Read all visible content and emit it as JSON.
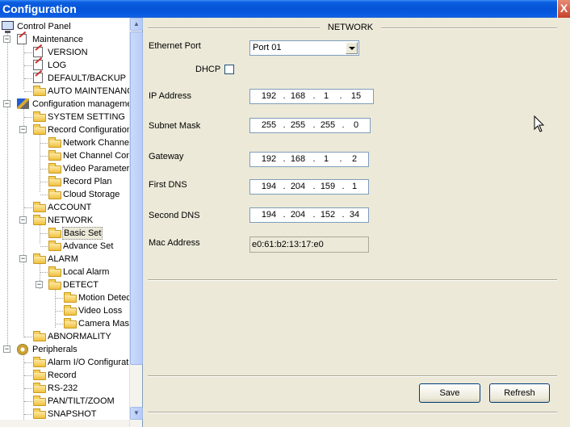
{
  "window": {
    "title": "Configuration",
    "close_label": "X"
  },
  "tree": {
    "items": [
      {
        "label": "Control Panel"
      },
      {
        "label": "Maintenance"
      },
      {
        "label": "VERSION"
      },
      {
        "label": "LOG"
      },
      {
        "label": "DEFAULT/BACKUP"
      },
      {
        "label": "AUTO MAINTENANCE"
      },
      {
        "label": "Configuration management"
      },
      {
        "label": "SYSTEM SETTING"
      },
      {
        "label": "Record Configuration"
      },
      {
        "label": "Network Channel"
      },
      {
        "label": "Net Channel Con"
      },
      {
        "label": "Video Parameter"
      },
      {
        "label": "Record Plan"
      },
      {
        "label": "Cloud Storage"
      },
      {
        "label": "ACCOUNT"
      },
      {
        "label": "NETWORK"
      },
      {
        "label": "Basic Set"
      },
      {
        "label": "Advance Set"
      },
      {
        "label": "ALARM"
      },
      {
        "label": "Local Alarm"
      },
      {
        "label": "DETECT"
      },
      {
        "label": "Motion Detect"
      },
      {
        "label": "Video Loss"
      },
      {
        "label": "Camera Mask"
      },
      {
        "label": "ABNORMALITY"
      },
      {
        "label": "Peripherals"
      },
      {
        "label": "Alarm I/O Configuration"
      },
      {
        "label": "Record"
      },
      {
        "label": "RS-232"
      },
      {
        "label": "PAN/TILT/ZOOM"
      },
      {
        "label": "SNAPSHOT"
      }
    ]
  },
  "network": {
    "section_title": "NETWORK",
    "ethernet_port_label": "Ethernet Port",
    "ethernet_port_value": "Port 01",
    "dhcp_label": "DHCP",
    "ip_label": "IP Address",
    "ip": [
      "192",
      "168",
      "1",
      "15"
    ],
    "subnet_label": "Subnet Mask",
    "subnet": [
      "255",
      "255",
      "255",
      "0"
    ],
    "gateway_label": "Gateway",
    "gateway": [
      "192",
      "168",
      "1",
      "2"
    ],
    "dns1_label": "First DNS",
    "dns1": [
      "194",
      "204",
      "159",
      "1"
    ],
    "dns2_label": "Second DNS",
    "dns2": [
      "194",
      "204",
      "152",
      "34"
    ],
    "mac_label": "Mac Address",
    "mac_value": "e0:61:b2:13:17:e0",
    "save_label": "Save",
    "refresh_label": "Refresh"
  }
}
